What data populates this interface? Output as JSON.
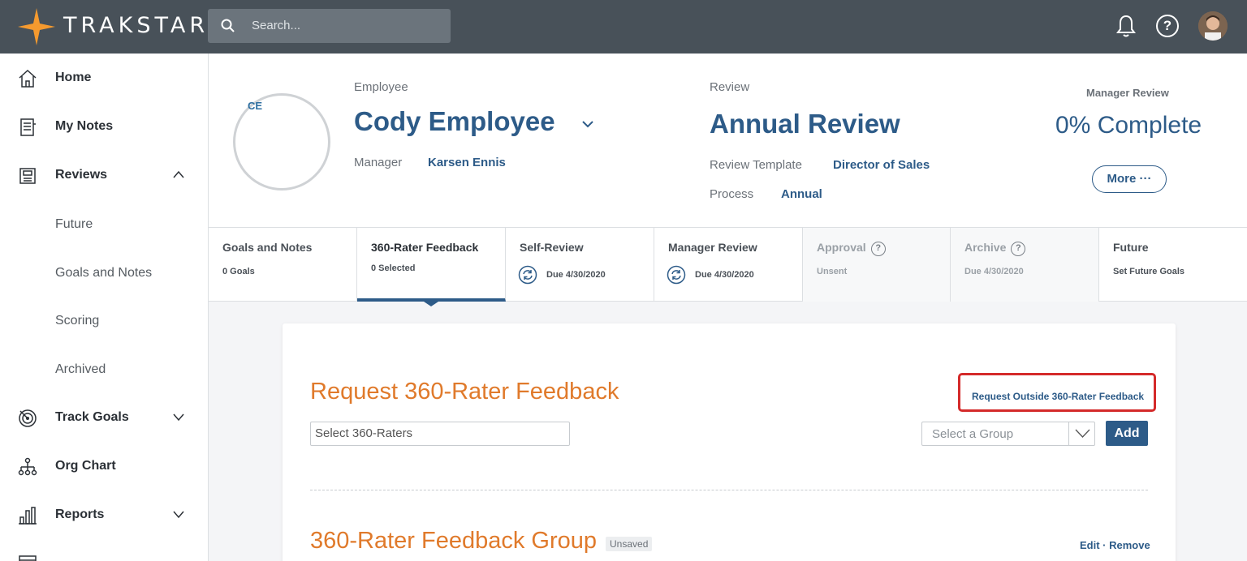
{
  "app": {
    "name": "TRAKSTAR",
    "brand_color": "#f59a2f"
  },
  "topbar": {
    "search_placeholder": "Search...",
    "help_symbol": "?"
  },
  "sidebar": {
    "items": [
      {
        "label": "Home",
        "icon": "home-icon"
      },
      {
        "label": "My Notes",
        "icon": "notes-icon"
      },
      {
        "label": "Reviews",
        "icon": "reviews-icon",
        "expanded": true
      },
      {
        "label": "Future"
      },
      {
        "label": "Goals and Notes"
      },
      {
        "label": "Scoring"
      },
      {
        "label": "Archived"
      },
      {
        "label": "Track Goals",
        "icon": "target-icon"
      },
      {
        "label": "Org Chart",
        "icon": "org-chart-icon"
      },
      {
        "label": "Reports",
        "icon": "reports-icon"
      }
    ]
  },
  "header": {
    "photo_text": "CE",
    "employee_label": "Employee",
    "employee_name": "Cody Employee",
    "manager_label": "Manager",
    "manager_name": "Karsen Ennis",
    "review_label": "Review",
    "review_name": "Annual Review",
    "template_label": "Review Template",
    "template_name": "Director of Sales",
    "process_label": "Process",
    "process_name": "Annual",
    "status_label": "Manager Review",
    "status_value": "0% Complete",
    "more_label": "More ···"
  },
  "tabs": [
    {
      "title": "Goals and Notes",
      "sub": "0 Goals"
    },
    {
      "title": "360-Rater Feedback",
      "sub": "0 Selected"
    },
    {
      "title": "Self-Review",
      "sub": "Due 4/30/2020"
    },
    {
      "title": "Manager Review",
      "sub": "Due 4/30/2020"
    },
    {
      "title": "Approval",
      "sub": "Unsent"
    },
    {
      "title": "Archive",
      "sub": "Due 4/30/2020"
    },
    {
      "title": "Future",
      "sub": "Set Future Goals"
    }
  ],
  "card": {
    "title": "Request 360-Rater Feedback",
    "outside_link": "Request Outside 360-Rater Feedback",
    "raters_placeholder": "Select 360-Raters",
    "group_placeholder": "Select a Group",
    "add_label": "Add",
    "group_title": "360-Rater Feedback Group",
    "unsaved_badge": "Unsaved",
    "edit_remove": "Edit · Remove"
  }
}
